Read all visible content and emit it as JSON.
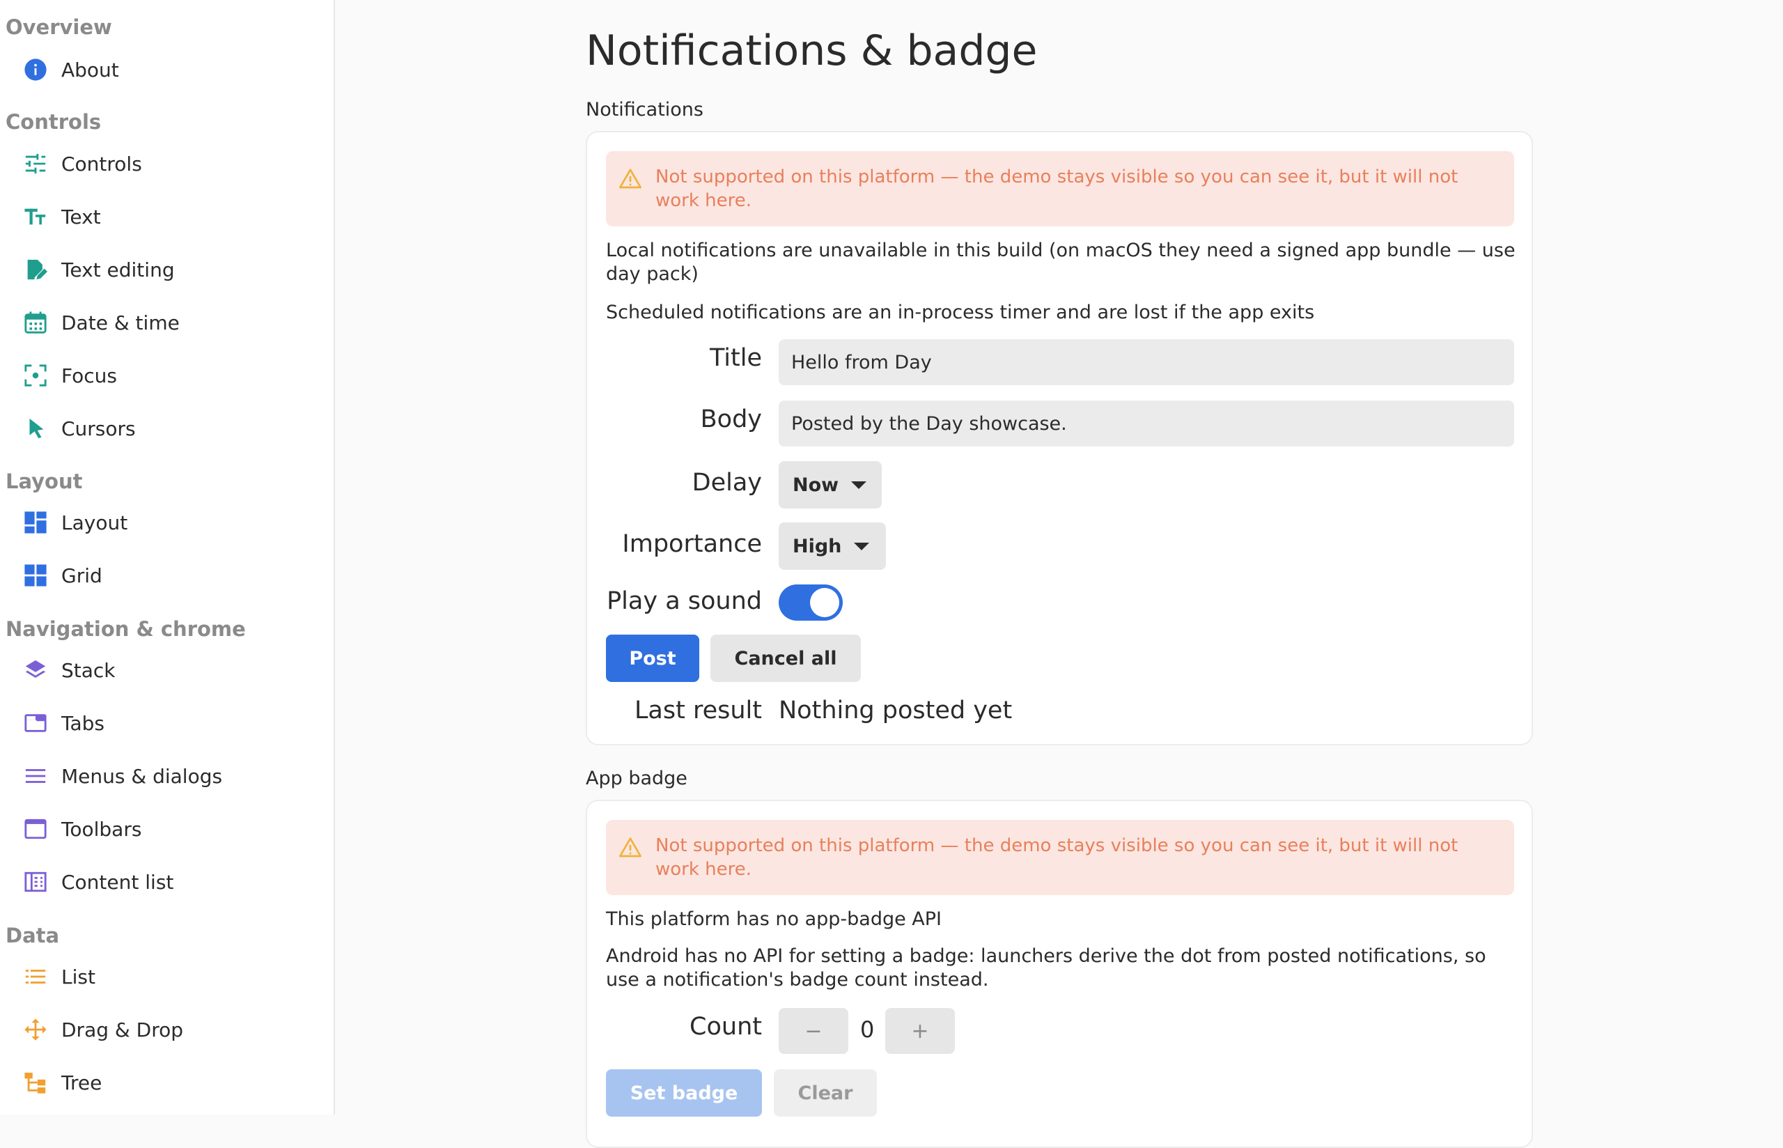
{
  "sidebar": {
    "sections": [
      {
        "title": "Overview",
        "items": [
          {
            "label": "About",
            "icon": "info-icon"
          }
        ]
      },
      {
        "title": "Controls",
        "items": [
          {
            "label": "Controls",
            "icon": "sliders-icon"
          },
          {
            "label": "Text",
            "icon": "text-size-icon"
          },
          {
            "label": "Text editing",
            "icon": "edit-document-icon"
          },
          {
            "label": "Date & time",
            "icon": "calendar-icon"
          },
          {
            "label": "Focus",
            "icon": "focus-icon"
          },
          {
            "label": "Cursors",
            "icon": "cursor-icon"
          }
        ]
      },
      {
        "title": "Layout",
        "items": [
          {
            "label": "Layout",
            "icon": "dashboard-icon"
          },
          {
            "label": "Grid",
            "icon": "grid-icon"
          }
        ]
      },
      {
        "title": "Navigation & chrome",
        "items": [
          {
            "label": "Stack",
            "icon": "layers-icon"
          },
          {
            "label": "Tabs",
            "icon": "tab-icon"
          },
          {
            "label": "Menus & dialogs",
            "icon": "menu-icon"
          },
          {
            "label": "Toolbars",
            "icon": "window-icon"
          },
          {
            "label": "Content list",
            "icon": "book-icon"
          }
        ]
      },
      {
        "title": "Data",
        "items": [
          {
            "label": "List",
            "icon": "list-icon"
          },
          {
            "label": "Drag & Drop",
            "icon": "move-icon"
          },
          {
            "label": "Tree",
            "icon": "tree-icon"
          }
        ]
      }
    ]
  },
  "page": {
    "title": "Notifications & badge"
  },
  "notifications": {
    "section_title": "Notifications",
    "warning": "Not supported on this platform — the demo stays visible so you can see it, but it will not work here.",
    "info1": "Local notifications are unavailable in this build (on macOS they need a signed app bundle — use day pack)",
    "info2": "Scheduled notifications are an in-process timer and are lost if the app exits",
    "title_label": "Title",
    "title_value": "Hello from Day",
    "body_label": "Body",
    "body_value": "Posted by the Day showcase.",
    "delay_label": "Delay",
    "delay_value": "Now",
    "importance_label": "Importance",
    "importance_value": "High",
    "sound_label": "Play a sound",
    "sound_on": true,
    "post_label": "Post",
    "cancel_all_label": "Cancel all",
    "last_result_label": "Last result",
    "last_result_value": "Nothing posted yet"
  },
  "badge": {
    "section_title": "App badge",
    "warning": "Not supported on this platform — the demo stays visible so you can see it, but it will not work here.",
    "info1": "This platform has no app-badge API",
    "info2": "Android has no API for setting a badge: launchers derive the dot from posted notifications, so use a notification's badge count instead.",
    "count_label": "Count",
    "minus": "−",
    "count_value": "0",
    "plus": "+",
    "set_badge_label": "Set badge",
    "clear_label": "Clear"
  },
  "colors": {
    "accent": "#2f6fdf",
    "warning_bg": "#fbe6e1",
    "warning_text": "#e8805c",
    "warning_icon": "#f0b23a",
    "controls_icons": "#1f9e8e",
    "layout_icons": "#2f6fdf",
    "navigation_icons": "#7b5fd6",
    "data_icons": "#f0a030"
  }
}
